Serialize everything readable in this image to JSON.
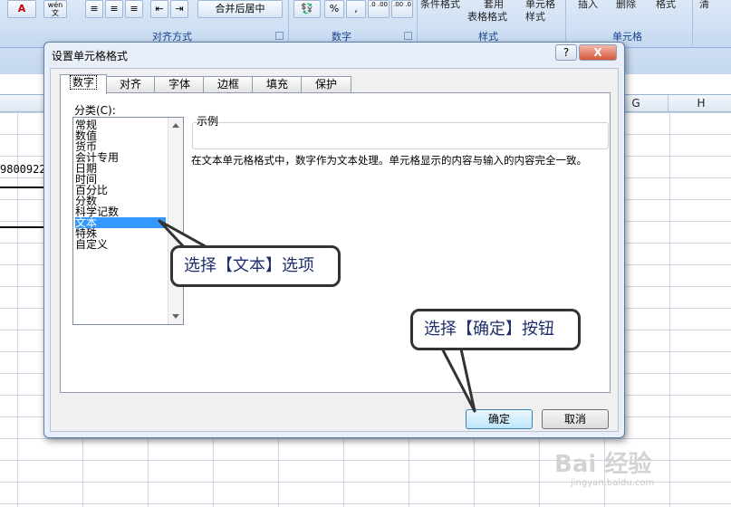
{
  "ribbon": {
    "font_color_glyph": "A",
    "wen_glyph": "wén 文",
    "merge_center": "合并后居中",
    "percent": "%",
    "comma": ",",
    "dec_inc": ".0 .00",
    "dec_dec": ".00 .0",
    "cond_format": "条件格式",
    "table_format": "套用",
    "table_format2": "表格格式",
    "cell_style": "单元格",
    "cell_style2": "样式",
    "insert": "插入",
    "delete": "删除",
    "format": "格式",
    "clear": "清",
    "group_alignment": "对齐方式",
    "group_number": "数字",
    "group_styles": "样式",
    "group_cells": "单元格"
  },
  "sheet": {
    "columns": [
      "G",
      "H"
    ],
    "cell_value": "9800922"
  },
  "dialog": {
    "title": "设置单元格格式",
    "help": "?",
    "close": "X",
    "tabs": [
      "数字",
      "对齐",
      "字体",
      "边框",
      "填充",
      "保护"
    ],
    "category_label": "分类(C):",
    "categories": [
      "常规",
      "数值",
      "货币",
      "会计专用",
      "日期",
      "时间",
      "百分比",
      "分数",
      "科学记数",
      "文本",
      "特殊",
      "自定义"
    ],
    "selected_category": "文本",
    "sample_label": "示例",
    "description": "在文本单元格格式中，数字作为文本处理。单元格显示的内容与输入的内容完全一致。",
    "ok_label": "确定",
    "cancel_label": "取消"
  },
  "annotations": {
    "callout_text": "选择【文本】选项",
    "callout_ok": "选择【确定】按钮"
  },
  "watermark": {
    "brand": "Bai 经验",
    "url": "jingyan.baidu.com"
  }
}
